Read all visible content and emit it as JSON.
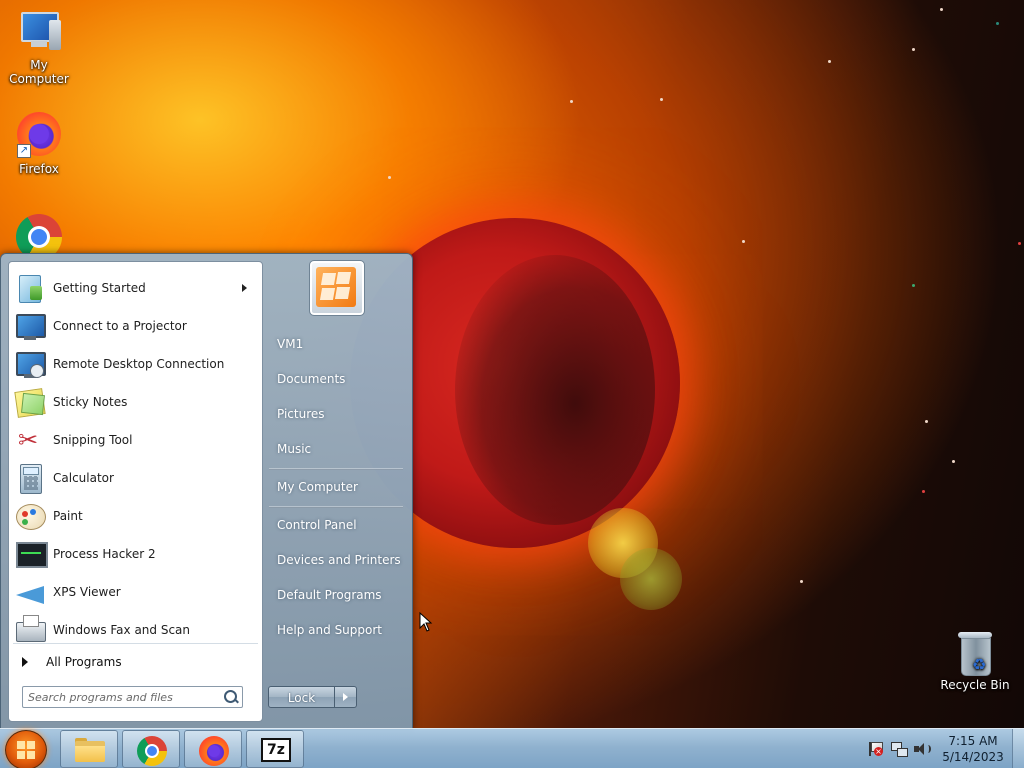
{
  "desktop": {
    "icons": [
      {
        "label": "My Computer",
        "icon": "computer-icon"
      },
      {
        "label": "Firefox",
        "icon": "firefox-icon"
      },
      {
        "label": "",
        "icon": "chrome-icon"
      },
      {
        "label": "Recycle Bin",
        "icon": "recycle-bin-icon"
      }
    ]
  },
  "start_menu": {
    "programs": [
      {
        "label": "Getting Started",
        "icon": "getting-started-icon",
        "has_submenu": true
      },
      {
        "label": "Connect to a Projector",
        "icon": "projector-icon"
      },
      {
        "label": "Remote Desktop Connection",
        "icon": "remote-desktop-icon"
      },
      {
        "label": "Sticky Notes",
        "icon": "sticky-notes-icon"
      },
      {
        "label": "Snipping Tool",
        "icon": "snipping-tool-icon"
      },
      {
        "label": "Calculator",
        "icon": "calculator-icon"
      },
      {
        "label": "Paint",
        "icon": "paint-icon"
      },
      {
        "label": "Process Hacker 2",
        "icon": "process-hacker-icon"
      },
      {
        "label": "XPS Viewer",
        "icon": "xps-viewer-icon"
      },
      {
        "label": "Windows Fax and Scan",
        "icon": "fax-scan-icon"
      }
    ],
    "all_programs_label": "All Programs",
    "search_placeholder": "Search programs and files",
    "user_picture_icon": "user-picture-icon",
    "right_items": [
      {
        "label": "VM1"
      },
      {
        "label": "Documents"
      },
      {
        "label": "Pictures"
      },
      {
        "label": "Music"
      },
      {
        "label": "My Computer"
      },
      {
        "label": "Control Panel"
      },
      {
        "label": "Devices and Printers"
      },
      {
        "label": "Default Programs"
      },
      {
        "label": "Help and Support"
      }
    ],
    "lock_label": "Lock"
  },
  "taskbar": {
    "start_icon": "windows-start-orb-icon",
    "pinned": [
      {
        "name": "file-explorer-icon"
      },
      {
        "name": "chrome-icon"
      },
      {
        "name": "firefox-icon"
      },
      {
        "name": "7zip-icon",
        "text": "7z"
      }
    ],
    "tray_icons": [
      "action-center-flag-icon",
      "network-icon",
      "volume-icon"
    ],
    "clock": {
      "time": "7:15 AM",
      "date": "5/14/2023"
    }
  },
  "colors": {
    "taskbar": "#8cafcd",
    "start_menu_right": "#8fa8be",
    "start_orb": "#e05a0a"
  }
}
